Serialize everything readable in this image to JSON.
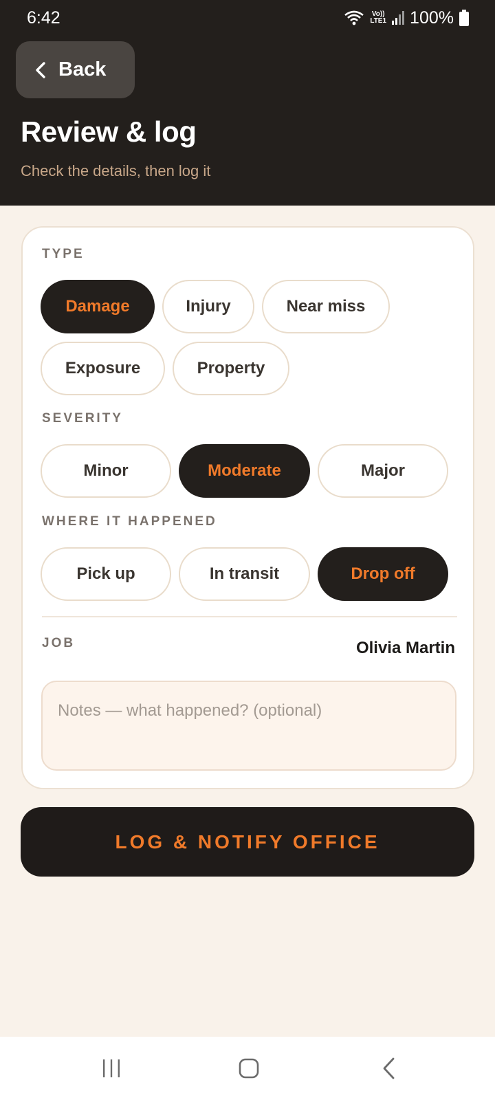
{
  "status_bar": {
    "time": "6:42",
    "volte_top": "Vo))",
    "volte_bottom": "LTE1",
    "battery": "100%"
  },
  "header": {
    "back_label": "Back",
    "title": "Review & log",
    "subtitle": "Check the details, then log it"
  },
  "form": {
    "type": {
      "label": "TYPE",
      "options": [
        "Damage",
        "Injury",
        "Near miss",
        "Exposure",
        "Property"
      ],
      "selected": "Damage"
    },
    "severity": {
      "label": "SEVERITY",
      "options": [
        "Minor",
        "Moderate",
        "Major"
      ],
      "selected": "Moderate"
    },
    "location": {
      "label": "WHERE IT HAPPENED",
      "options": [
        "Pick up",
        "In transit",
        "Drop off"
      ],
      "selected": "Drop off"
    },
    "job": {
      "label": "JOB",
      "value": "Olivia Martin"
    },
    "notes": {
      "value": "",
      "placeholder": "Notes — what happened? (optional)"
    }
  },
  "submit_label": "LOG & NOTIFY OFFICE",
  "colors": {
    "header_bg": "#231f1c",
    "page_bg": "#f9f2ea",
    "accent": "#f07a2a",
    "subtitle": "#c8a789"
  },
  "icons": {
    "back": "chevron-left-icon",
    "wifi": "wifi-icon",
    "signal": "signal-icon",
    "battery": "battery-icon",
    "nav_recents": "recents-icon",
    "nav_home": "home-icon",
    "nav_back": "back-nav-icon"
  }
}
